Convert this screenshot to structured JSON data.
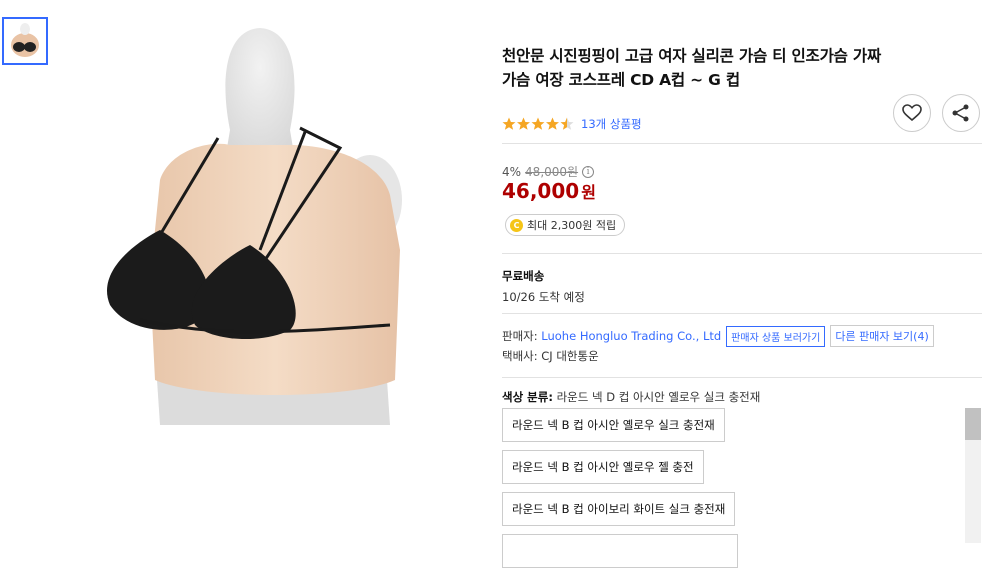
{
  "thumbnails": [
    {
      "icon": "product-thumbnail"
    }
  ],
  "product": {
    "title": "천안문 시진핑핑이 고급 여자 실리콘 가슴 티 인조가슴 가짜가슴 여장 코스프레 CD A컵 ~ G 컵",
    "rating": 4.5,
    "review_text": "13개 상품평"
  },
  "actions": {
    "wishlist_icon": "heart-icon",
    "share_icon": "share-icon"
  },
  "pricing": {
    "discount": "4%",
    "original_price": "48,000원",
    "price": "46,000",
    "currency": "원",
    "points": "최대 2,300원 적립",
    "points_icon": "C"
  },
  "shipping": {
    "label": "무료배송",
    "arrival": "10/26 도착 예정"
  },
  "seller": {
    "label": "판매자:",
    "name": "Luohe Hongluo Trading Co., Ltd",
    "view_products": "판매자 상품 보러가기",
    "other_sellers": "다른 판매자 보기(4)",
    "carrier": "택배사: CJ 대한통운"
  },
  "options": {
    "label": "색상 분류:",
    "selected": "라운드 넥 D 컵 아시안 옐로우 실크 충전재",
    "items": [
      "라운드 넥 B 컵 아시안 옐로우 실크 충전재",
      "라운드 넥 B 컵 아시안 옐로우 젤 충전",
      "라운드 넥 B 컵 아이보리 화이트 실크 충전재"
    ]
  },
  "colors": {
    "accent": "#346aff",
    "price": "#ae0000",
    "star": "#f5a623"
  }
}
